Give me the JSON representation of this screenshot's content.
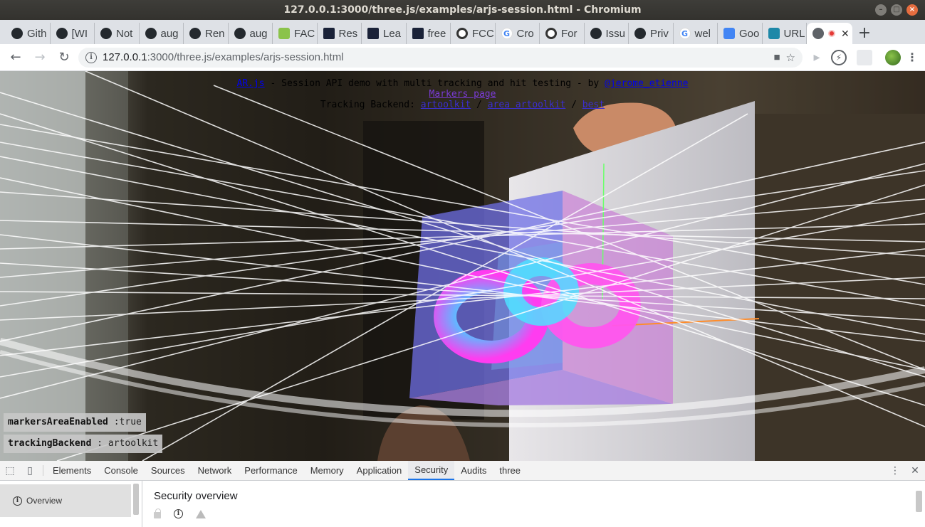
{
  "window": {
    "title": "127.0.0.1:3000/three.js/examples/arjs-session.html - Chromium"
  },
  "tabs": [
    {
      "label": "Gith",
      "icon": "github-icon"
    },
    {
      "label": "[WI",
      "icon": "github-icon"
    },
    {
      "label": "Not",
      "icon": "github-icon"
    },
    {
      "label": "aug",
      "icon": "github-icon"
    },
    {
      "label": "Ren",
      "icon": "github-icon"
    },
    {
      "label": "aug",
      "icon": "github-icon"
    },
    {
      "label": "FAC",
      "icon": "fac-icon"
    },
    {
      "label": "Res",
      "icon": "a-logo-icon"
    },
    {
      "label": "Lea",
      "icon": "a-logo-icon"
    },
    {
      "label": "free",
      "icon": "a-logo-icon"
    },
    {
      "label": "FCC",
      "icon": "hex-logo-icon"
    },
    {
      "label": "Cro",
      "icon": "google-icon"
    },
    {
      "label": "For",
      "icon": "hex-logo-icon"
    },
    {
      "label": "Issu",
      "icon": "github-icon"
    },
    {
      "label": "Priv",
      "icon": "github-icon"
    },
    {
      "label": "wel",
      "icon": "google-icon"
    },
    {
      "label": "Goo",
      "icon": "google-translate-icon"
    },
    {
      "label": "URL",
      "icon": "url-icon"
    }
  ],
  "toolbar": {
    "url_host": "127.0.0.1",
    "url_path": ":3000/three.js/examples/arjs-session.html"
  },
  "page": {
    "arjs_link": "AR.js",
    "intro_text": " - Session API demo with multi tracking and hit testing - by ",
    "author_link": "@jerome_etienne",
    "markers_link": "Markers page",
    "backend_label": "Tracking Backend: ",
    "backend_options": [
      "artoolkit",
      "area artoolkit",
      "best"
    ],
    "separator": " / ",
    "status": [
      {
        "key": "markersAreaEnabled",
        "value": " :true"
      },
      {
        "key": "trackingBackend",
        "value": " : artoolkit"
      }
    ]
  },
  "devtools": {
    "tabs": [
      "Elements",
      "Console",
      "Sources",
      "Network",
      "Performance",
      "Memory",
      "Application",
      "Security",
      "Audits",
      "three"
    ],
    "active_tab": "Security",
    "sidebar_item": "Overview",
    "heading": "Security overview"
  }
}
